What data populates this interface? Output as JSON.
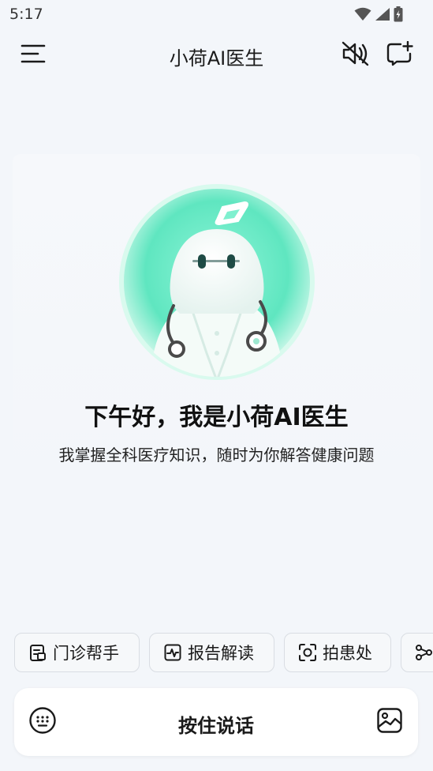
{
  "status_bar": {
    "time": "5:17"
  },
  "app_bar": {
    "title": "小荷AI医生"
  },
  "hero": {
    "greeting": "下午好，我是小荷AI医生",
    "subtitle": "我掌握全科医疗知识，随时为你解答健康问题"
  },
  "quick_actions": [
    {
      "label": "门诊帮手",
      "icon": "clipboard-icon"
    },
    {
      "label": "报告解读",
      "icon": "report-chart-icon"
    },
    {
      "label": "拍患处",
      "icon": "scan-camera-icon"
    },
    {
      "label": "",
      "icon": "share-nodes-icon"
    }
  ],
  "input_bar": {
    "hold_to_talk": "按住说话"
  },
  "colors": {
    "background": "#f3f6fa",
    "accent_mint": "#5fe6c0",
    "text_primary": "#111111"
  }
}
